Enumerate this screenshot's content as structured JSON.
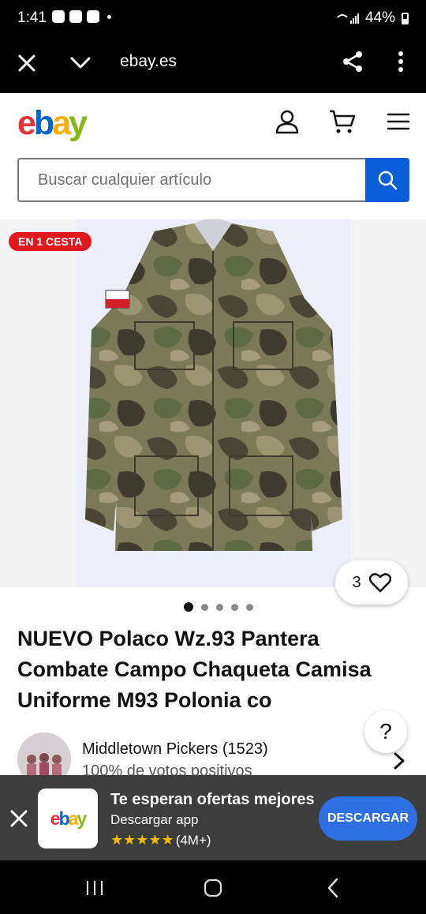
{
  "status_bar": {
    "time": "1:41",
    "battery": "44%"
  },
  "browser": {
    "url": "ebay.es"
  },
  "header": {
    "logo": {
      "e": "e",
      "b": "b",
      "a": "a",
      "y": "y"
    },
    "search_placeholder": "Buscar cualquier artículo"
  },
  "gallery": {
    "badge": "EN 1 CESTA",
    "watch_count": "3",
    "image_count": 5,
    "active_image": 1
  },
  "listing": {
    "title": "NUEVO Polaco Wz.93 Pantera Combate Campo Chaqueta Camisa Uniforme M93 Polonia co"
  },
  "help": {
    "label": "?"
  },
  "seller": {
    "name": "Middletown Pickers (1523)",
    "feedback": "100% de votos positivos"
  },
  "promo": {
    "logo_text": "ebay",
    "title": "Te esperan ofertas mejores",
    "subtitle": "Descargar app",
    "stars": "★★★★★",
    "reviews": "(4M+)",
    "button": "DESCARGAR"
  },
  "colors": {
    "brand_red": "#e53238",
    "brand_blue": "#0064d2",
    "brand_yellow": "#f5af02",
    "brand_green": "#86b817",
    "search_button": "#0a5fd8",
    "badge_red": "#e0191f",
    "promo_button": "#2f6fe4"
  }
}
